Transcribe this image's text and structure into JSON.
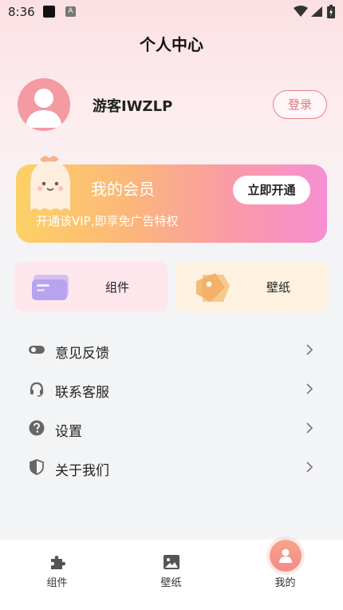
{
  "status_bar": {
    "time": "8:36",
    "notif_letter": "A"
  },
  "header": {
    "title": "个人中心"
  },
  "profile": {
    "username": "游客IWZLP",
    "login_label": "登录"
  },
  "vip": {
    "title": "我的会员",
    "subtitle": "开通该VIP,即享免广告特权",
    "button_label": "立即开通"
  },
  "tiles": [
    {
      "label": "组件",
      "icon": "widget-card-icon"
    },
    {
      "label": "壁纸",
      "icon": "wallpaper-tag-icon"
    }
  ],
  "menu": [
    {
      "label": "意见反馈",
      "icon": "toggle-icon"
    },
    {
      "label": "联系客服",
      "icon": "headset-icon"
    },
    {
      "label": "设置",
      "icon": "help-circle-icon"
    },
    {
      "label": "关于我们",
      "icon": "shield-icon"
    }
  ],
  "bottom_nav": {
    "items": [
      {
        "label": "组件",
        "icon": "puzzle-icon"
      },
      {
        "label": "壁纸",
        "icon": "image-icon"
      },
      {
        "label": "我的",
        "icon": "person-icon",
        "active": true
      }
    ]
  },
  "colors": {
    "accent": "#e98089",
    "vip_start": "#fcd165",
    "vip_end": "#f68fd2"
  }
}
